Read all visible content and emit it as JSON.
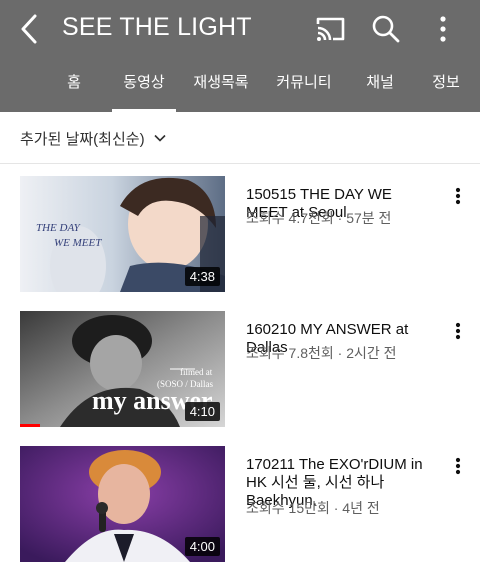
{
  "header": {
    "title": "SEE THE LIGHT",
    "icons": [
      "back-arrow-icon",
      "cast-icon",
      "search-icon",
      "more-vert-icon"
    ]
  },
  "tabs": [
    {
      "label": "홈",
      "active": false
    },
    {
      "label": "동영상",
      "active": true
    },
    {
      "label": "재생목록",
      "active": false
    },
    {
      "label": "커뮤니티",
      "active": false
    },
    {
      "label": "채널",
      "active": false
    },
    {
      "label": "정보",
      "active": false
    }
  ],
  "sort": {
    "label": "추가된 날짜(최신순)"
  },
  "videos": [
    {
      "title": "150515 THE DAY WE MEET at Seoul",
      "meta": "조회수 4.7천회 · 57분 전",
      "duration": "4:38",
      "overlay_text": [
        "THE DAY",
        "WE MEET"
      ]
    },
    {
      "title": "160210 MY ANSWER at Dallas",
      "meta": "조회수 7.8천회 · 2시간 전",
      "duration": "4:10",
      "overlay_text": [
        "filmed at",
        "(SOSO / Dallas",
        "my answer"
      ]
    },
    {
      "title": "170211 The EXO'rDIUM in HK 시선 둘, 시선 하나 Baekhyun.",
      "meta": "조회수 15만회 · 4년 전",
      "duration": "4:00"
    }
  ],
  "colors": {
    "appbar": "#6b6b6b",
    "meta_text": "#606060",
    "accent_bar": "#ff0000"
  }
}
